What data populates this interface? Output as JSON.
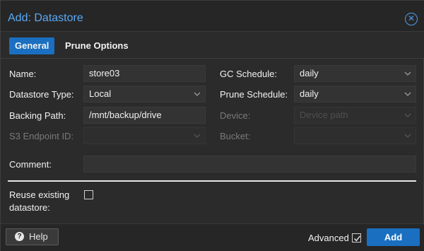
{
  "dialog": {
    "title": "Add: Datastore",
    "close_icon": "close-icon"
  },
  "tabs": [
    {
      "label": "General",
      "active": true
    },
    {
      "label": "Prune Options",
      "active": false
    }
  ],
  "form": {
    "name": {
      "label": "Name:",
      "value": "store03"
    },
    "datastore_type": {
      "label": "Datastore Type:",
      "value": "Local"
    },
    "backing_path": {
      "label": "Backing Path:",
      "value": "/mnt/backup/drive"
    },
    "s3_endpoint": {
      "label": "S3 Endpoint ID:",
      "value": "",
      "disabled": true
    },
    "gc_schedule": {
      "label": "GC Schedule:",
      "value": "daily"
    },
    "prune_schedule": {
      "label": "Prune Schedule:",
      "value": "daily"
    },
    "device": {
      "label": "Device:",
      "placeholder": "Device path",
      "disabled": true
    },
    "bucket": {
      "label": "Bucket:",
      "value": "",
      "disabled": true
    },
    "comment": {
      "label": "Comment:",
      "value": ""
    },
    "reuse": {
      "label_line1": "Reuse existing",
      "label_line2": "datastore:",
      "checked": false
    }
  },
  "footer": {
    "help_label": "Help",
    "advanced_label": "Advanced",
    "advanced_checked": true,
    "add_label": "Add"
  },
  "colors": {
    "accent": "#1a6fc1",
    "title": "#5aa9f5",
    "background": "#2b2b2b"
  }
}
